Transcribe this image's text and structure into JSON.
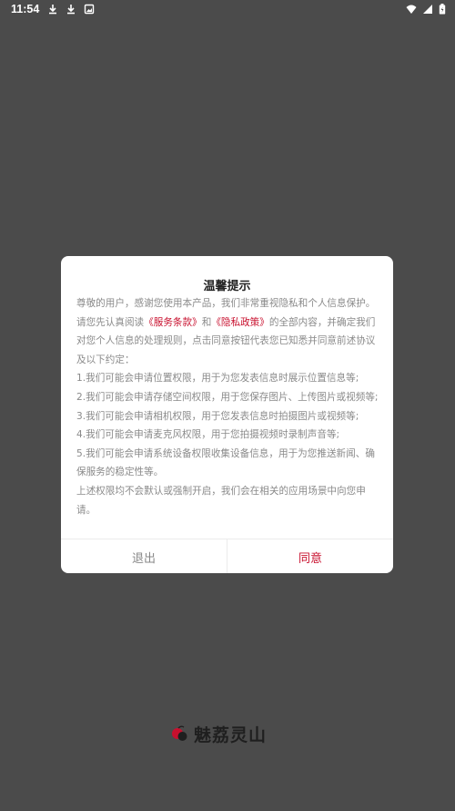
{
  "status_bar": {
    "time": "11:54",
    "left_icons": [
      "download-icon",
      "download-icon",
      "gallery-notification-icon"
    ],
    "right_icons": [
      "wifi-icon",
      "cell-signal-icon",
      "battery-icon"
    ]
  },
  "dialog": {
    "title": "温馨提示",
    "intro_prefix": "尊敬的用户，感谢您使用本产品，我们非常重视隐私和个人信息保护。请您先认真阅读",
    "terms_link": "《服务条款》",
    "and": "和",
    "privacy_link": "《隐私政策》",
    "intro_suffix": "的全部内容，并确定我们对您个人信息的处理规则，点击同意按钮代表您已知悉并同意前述协议及以下约定：",
    "items": [
      "1.我们可能会申请位置权限，用于为您发表信息时展示位置信息等;",
      "2.我们可能会申请存储空间权限，用于您保存图片、上传图片或视频等;",
      "3.我们可能会申请相机权限，用于您发表信息时拍摄图片或视频等;",
      "4.我们可能会申请麦克风权限，用于您拍摄视频时录制声音等;",
      "5.我们可能会申请系统设备权限收集设备信息，用于为您推送新闻、确保服务的稳定性等。",
      "上述权限均不会默认或强制开启，我们会在相关的应用场景中向您申请。"
    ],
    "exit_label": "退出",
    "agree_label": "同意"
  },
  "brand": {
    "name": "魅荔灵山",
    "accent_color": "#c8102e"
  }
}
